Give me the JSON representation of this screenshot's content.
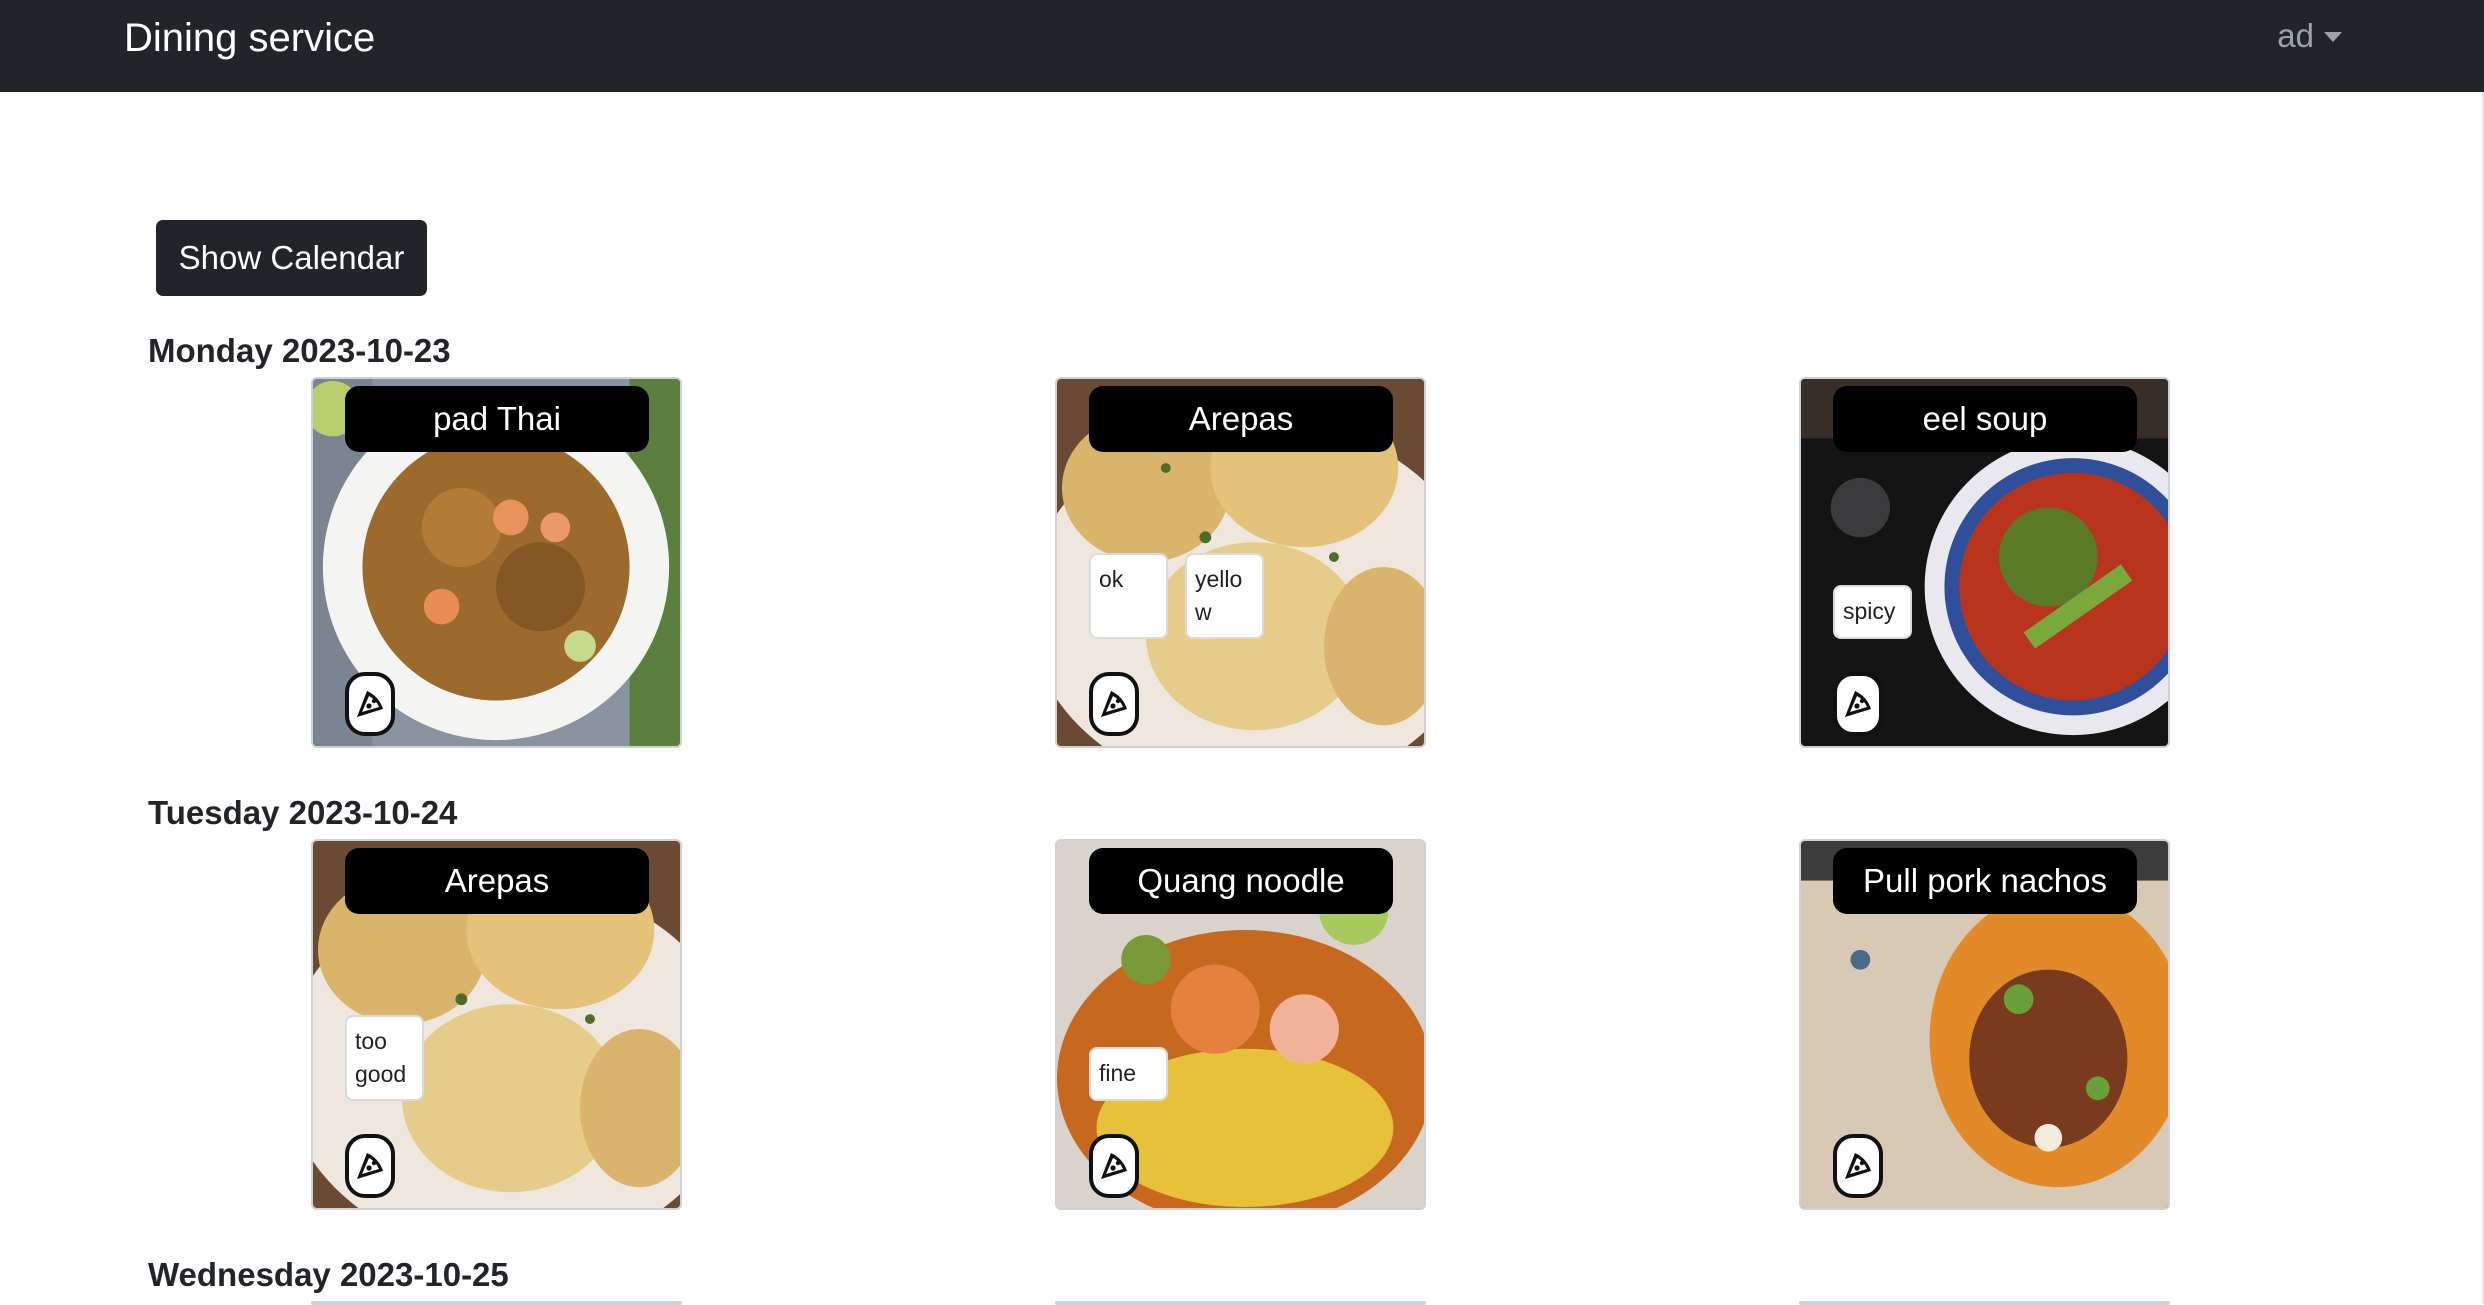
{
  "header": {
    "brand": "Dining service",
    "user": "ad"
  },
  "toolbar": {
    "show_calendar": "Show Calendar"
  },
  "days": [
    {
      "label": "Monday 2023-10-23",
      "meals": [
        {
          "name": "pad Thai",
          "notes": []
        },
        {
          "name": "Arepas",
          "notes": [
            "ok",
            "yello w"
          ]
        },
        {
          "name": "eel soup",
          "notes": [
            "spicy"
          ]
        }
      ]
    },
    {
      "label": "Tuesday 2023-10-24",
      "meals": [
        {
          "name": "Arepas",
          "notes": [
            "too good"
          ]
        },
        {
          "name": "Quang noodle",
          "notes": [
            "fine"
          ]
        },
        {
          "name": "Pull pork nachos",
          "notes": []
        }
      ]
    },
    {
      "label": "Wednesday 2023-10-25",
      "meals": []
    }
  ],
  "icons": {
    "user_caret": "chevron-down-icon",
    "feedback": "pizza-icon"
  },
  "colors": {
    "navbar": "#212529",
    "pill": "#000000",
    "button": "#212529"
  }
}
